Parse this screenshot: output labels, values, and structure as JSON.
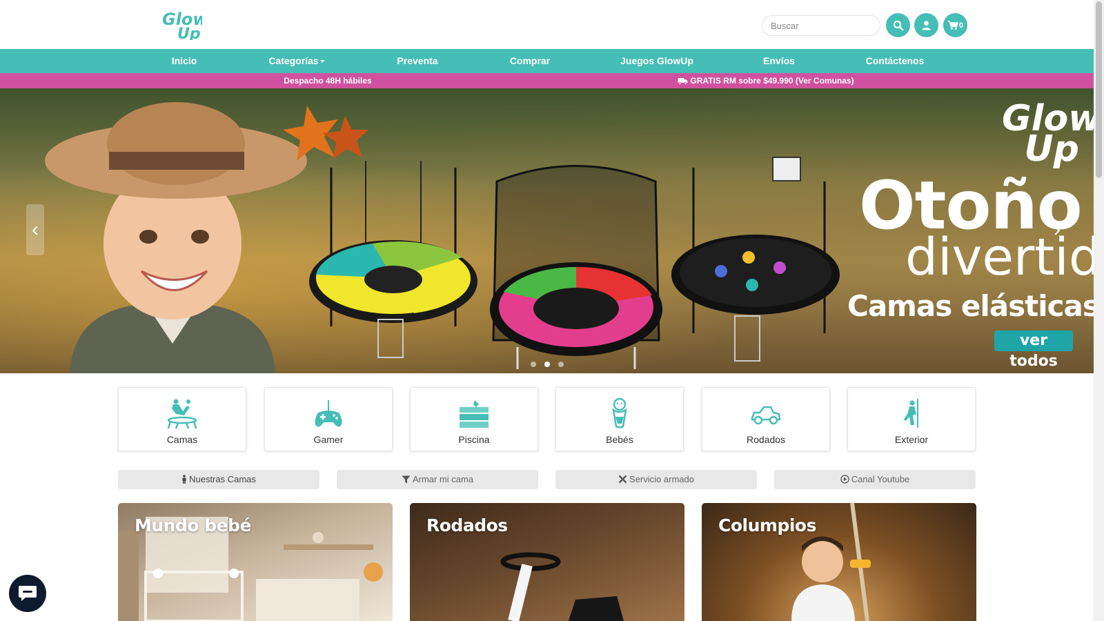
{
  "brand": {
    "logo_text": "Glow Up",
    "accent_color": "#45beb6",
    "promo_color": "#d0519e"
  },
  "header": {
    "search_placeholder": "Buscar",
    "search_icon": "search-icon",
    "user_icon": "user-icon",
    "cart_icon": "cart-icon",
    "cart_count": "0"
  },
  "nav": {
    "items": [
      {
        "label": "Inicio"
      },
      {
        "label": "Categorías"
      },
      {
        "label": "Preventa"
      },
      {
        "label": "Comprar"
      },
      {
        "label": "Juegos GlowUp"
      },
      {
        "label": "Envíos"
      },
      {
        "label": "Contáctenos"
      }
    ]
  },
  "promo": {
    "left": "Despacho 48H hábiles",
    "right": "GRATIS RM sobre $49.990 (Ver Comunas)"
  },
  "hero": {
    "logo_text": "Glow Up",
    "line1": "Otoño",
    "line2": "divertid",
    "line3": "Camas elásticas",
    "cta": "ver todos",
    "prev": "‹",
    "next": "›",
    "slides_total": 3,
    "slide_active": 1
  },
  "categories": [
    {
      "label": "Camas",
      "icon": "trampoline-icon"
    },
    {
      "label": "Gamer",
      "icon": "gamepad-icon"
    },
    {
      "label": "Piscina",
      "icon": "pool-icon"
    },
    {
      "label": "Bebés",
      "icon": "baby-icon"
    },
    {
      "label": "Rodados",
      "icon": "car-icon"
    },
    {
      "label": "Exterior",
      "icon": "climber-icon"
    }
  ],
  "quick_links": [
    {
      "label": "Nuestras Camas",
      "icon": "person-icon"
    },
    {
      "label": "Armar mi cama",
      "icon": "filter-icon"
    },
    {
      "label": "Servicio armado",
      "icon": "tools-icon"
    },
    {
      "label": "Canal Youtube",
      "icon": "play-circle-icon"
    }
  ],
  "banners": [
    {
      "title": "Mundo bebé"
    },
    {
      "title": "Rodados"
    },
    {
      "title": "Columpios"
    }
  ],
  "chat": {
    "icon": "chat-icon"
  }
}
